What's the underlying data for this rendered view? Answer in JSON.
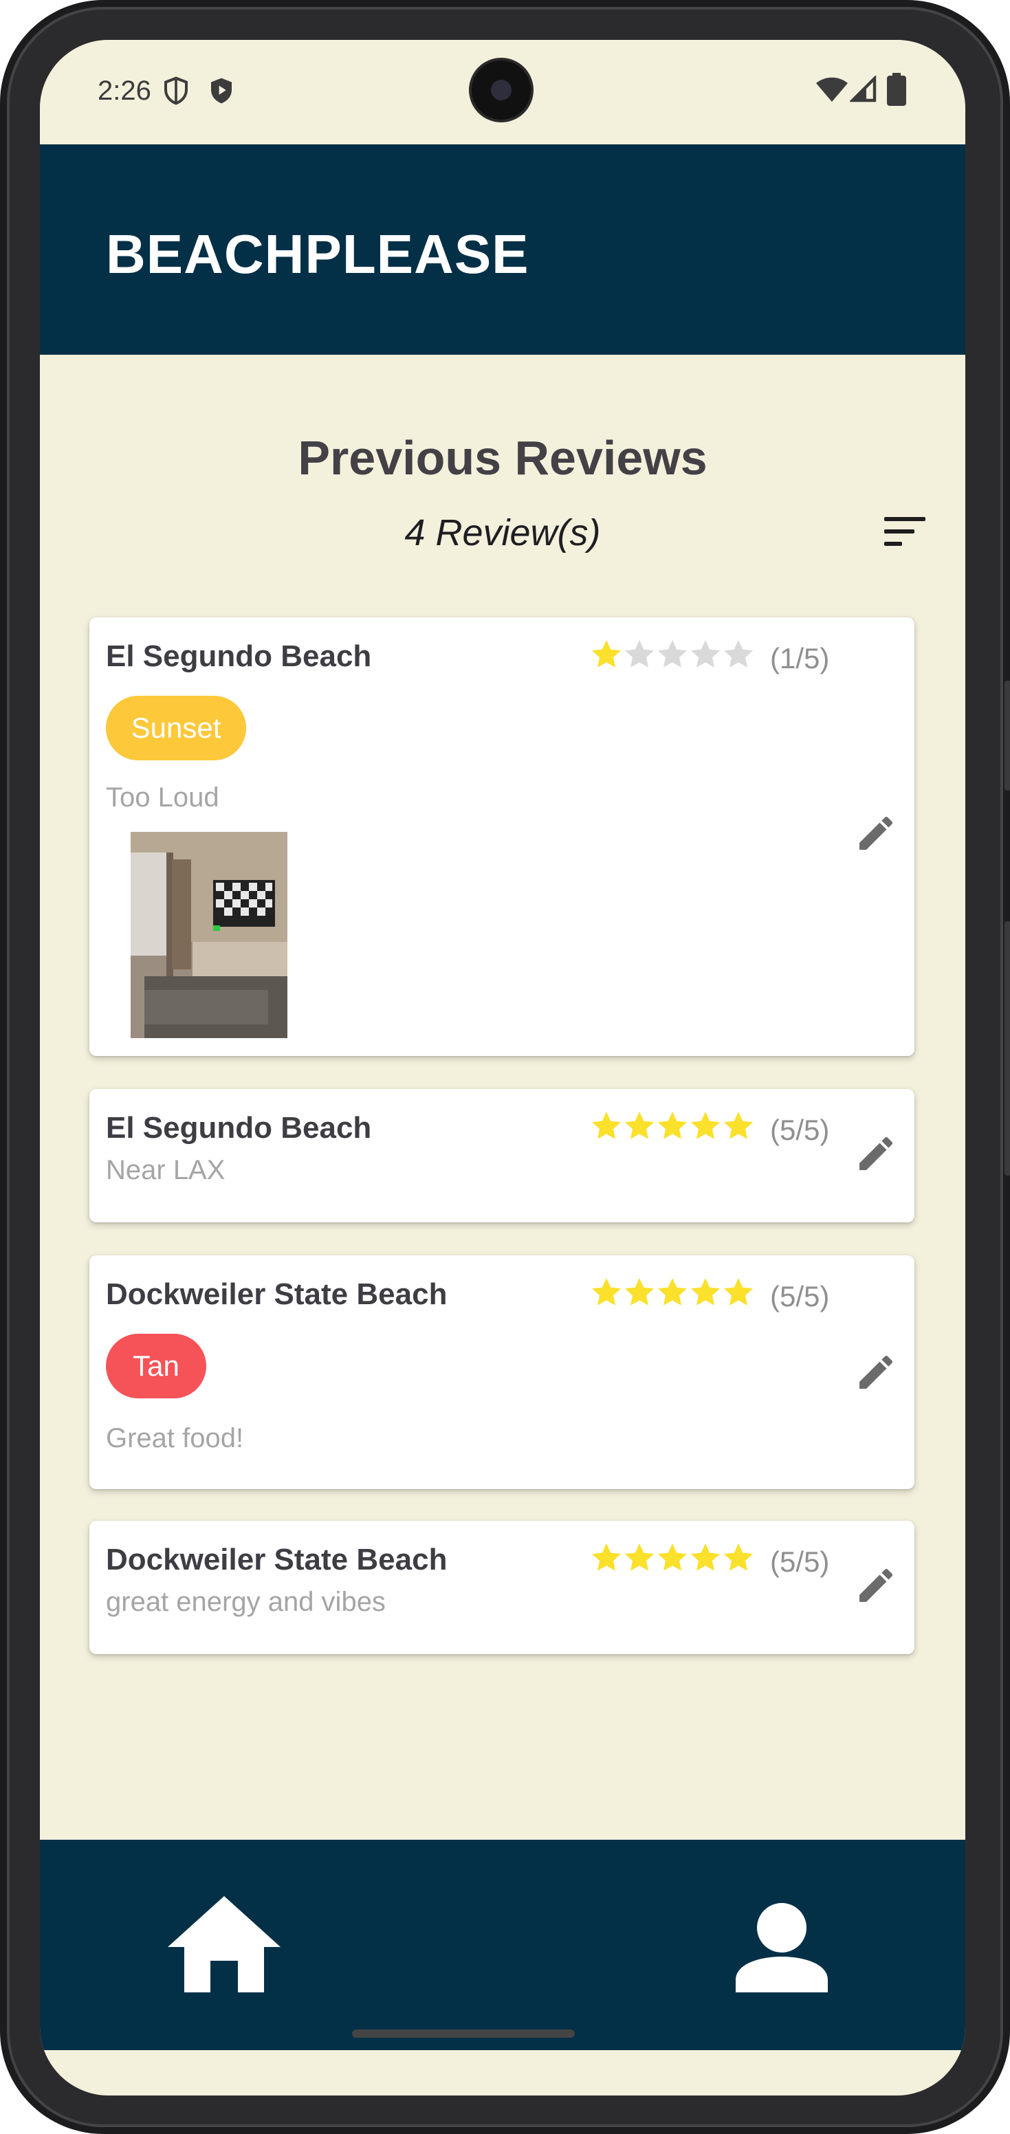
{
  "status_bar": {
    "time": "2:26"
  },
  "app_bar": {
    "title": "BEACHPLEASE"
  },
  "page": {
    "title": "Previous Reviews",
    "review_count": "4 Review(s)"
  },
  "colors": {
    "app_bar_bg": "#043047",
    "page_bg": "#f3f0dc",
    "star_filled": "#fbe02c",
    "star_empty": "#d9d9d9",
    "tag_sunset": "#fdc83a",
    "tag_tan": "#f65358",
    "edit_icon": "#6b6b6b"
  },
  "reviews": [
    {
      "beach": "El Segundo Beach",
      "rating": 1,
      "rating_label": "(1/5)",
      "tag": "Sunset",
      "note": "Too Loud",
      "has_photo": true
    },
    {
      "beach": "El Segundo Beach",
      "rating": 5,
      "rating_label": "(5/5)",
      "note": "Near LAX"
    },
    {
      "beach": "Dockweiler State Beach",
      "rating": 5,
      "rating_label": "(5/5)",
      "tag": "Tan",
      "note": "Great food!"
    },
    {
      "beach": "Dockweiler State Beach",
      "rating": 5,
      "rating_label": "(5/5)",
      "note": "great energy and vibes"
    }
  ],
  "icons": {
    "sort": "sort-icon",
    "edit": "pencil-icon",
    "home": "home-icon",
    "profile": "person-icon"
  }
}
